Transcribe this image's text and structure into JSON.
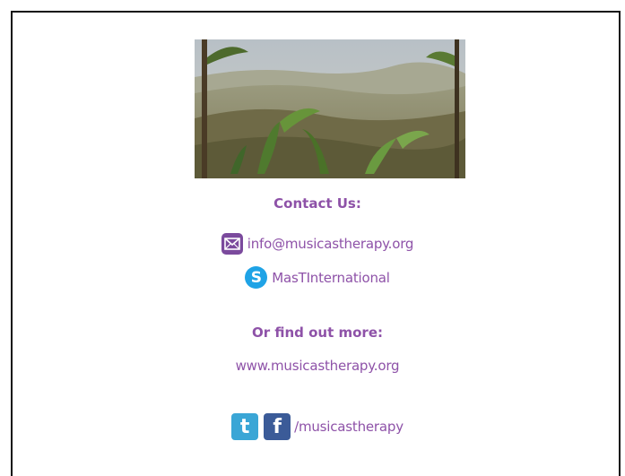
{
  "contact": {
    "heading": "Contact Us:",
    "email": "info@musicastherapy.org",
    "skype": "MasTInternational"
  },
  "more": {
    "heading": "Or find out more:",
    "website": "www.musicastherapy.org"
  },
  "social": {
    "handle": "/musicastherapy",
    "twitter_glyph": "t",
    "facebook_glyph": "f",
    "skype_glyph": "S"
  },
  "colors": {
    "text_purple": "#8e52a8",
    "email_icon": "#7b4a9d",
    "skype_icon": "#1fa3e6",
    "twitter_icon": "#3aa6d6",
    "facebook_icon": "#3b5b98"
  },
  "icons": {
    "email": "envelope-icon",
    "skype": "skype-icon",
    "twitter": "twitter-icon",
    "facebook": "facebook-icon"
  }
}
